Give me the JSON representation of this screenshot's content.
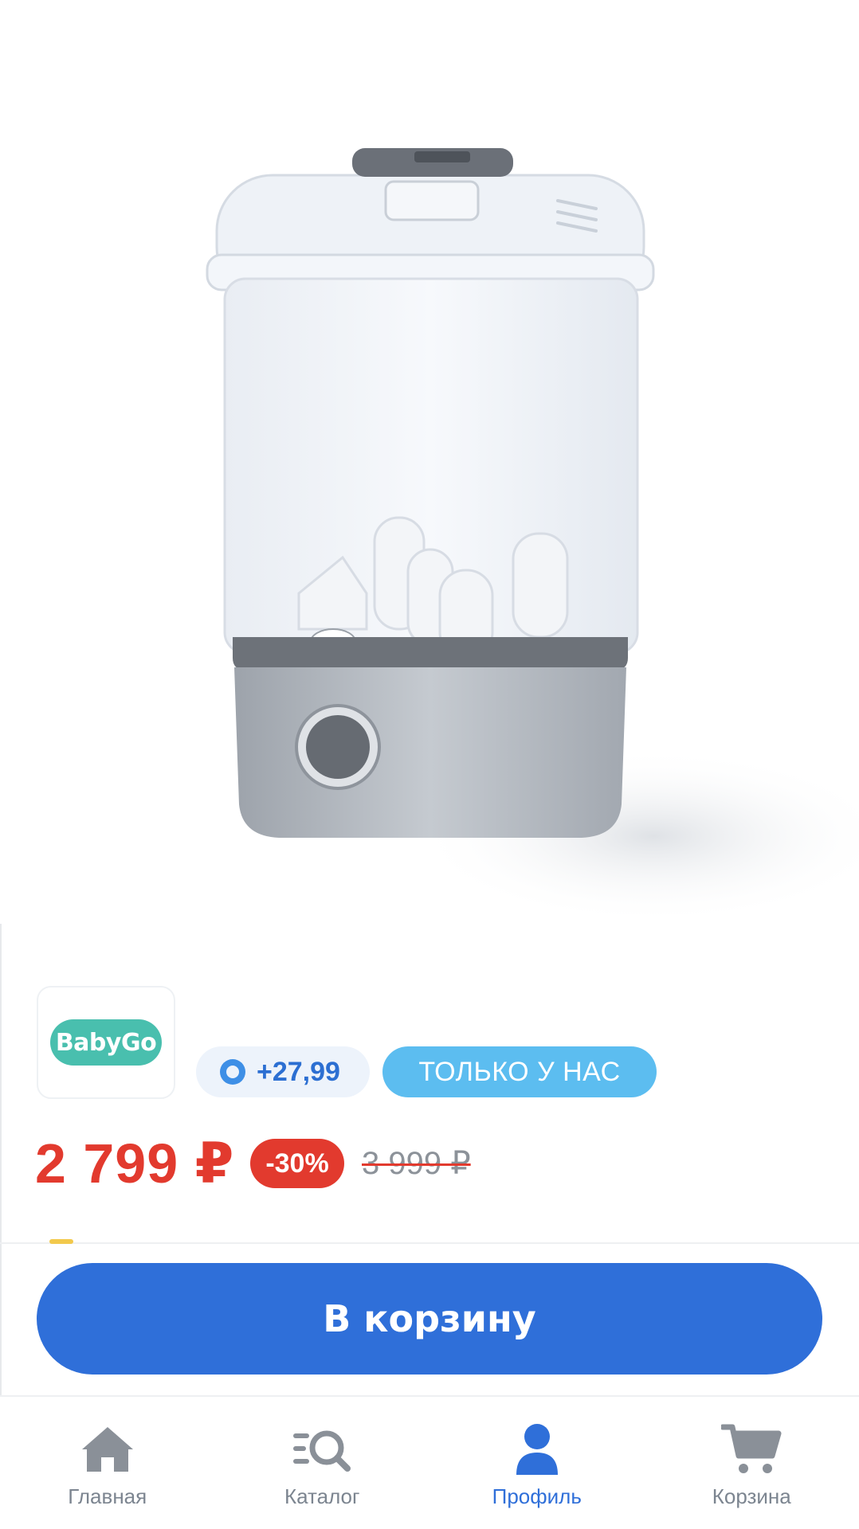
{
  "product": {
    "brand": "BabyGo",
    "bonus": "+27,99",
    "badge": "ТОЛЬКО У НАС",
    "price": "2 799 ₽",
    "discount": "-30%",
    "old_price": "3 999 ₽"
  },
  "cta": {
    "label": "В корзину"
  },
  "nav": {
    "items": [
      {
        "label": "Главная",
        "icon": "home-icon"
      },
      {
        "label": "Каталог",
        "icon": "catalog-search-icon"
      },
      {
        "label": "Профиль",
        "icon": "profile-icon",
        "active": true
      },
      {
        "label": "Корзина",
        "icon": "cart-icon"
      }
    ]
  },
  "colors": {
    "price_red": "#e23a2e",
    "primary_blue": "#2f6fd9",
    "badge_blue": "#5cbdf0",
    "brand_teal": "#49bfae"
  }
}
